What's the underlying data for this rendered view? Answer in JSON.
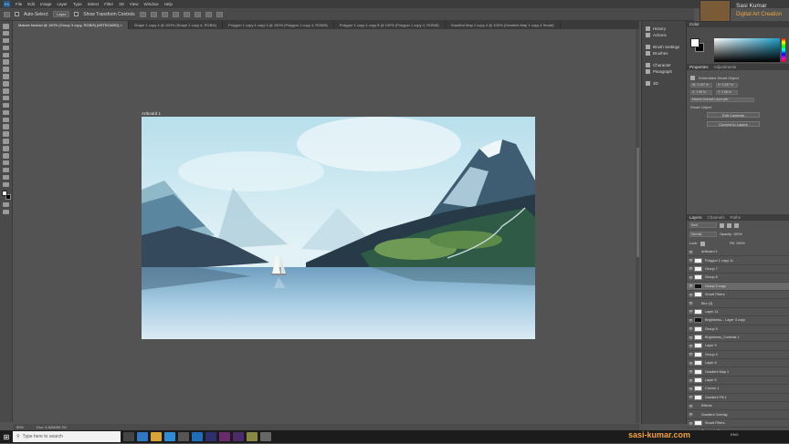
{
  "menu": {
    "logo": "Ps",
    "items": [
      "File",
      "Edit",
      "Image",
      "Layer",
      "Type",
      "Select",
      "Filter",
      "3D",
      "View",
      "Window",
      "Help"
    ]
  },
  "options_bar": {
    "auto_select_label": "Auto-Select:",
    "auto_select_value": "Layer",
    "show_transform_label": "Show Transform Controls"
  },
  "tabs": [
    {
      "label": "Mature-Nomad @ 100% (Group 3 copy, RGB/8) [ARTBOARD] ×",
      "active": true
    },
    {
      "label": "Shape 1 copy 4 @ 100% (Shape 1 copy 4, RGB/8)",
      "active": false
    },
    {
      "label": "Polygon 1 copy 4 copy 4 @ 100% (Polygon 1 copy 4, RGB/8)",
      "active": false
    },
    {
      "label": "Polygon 1 copy 4 copy 8 @ 100% (Polygon 1 copy 4, RGB/8)",
      "active": false
    },
    {
      "label": "Gradient Map 1 copy 4 @ 100% (Gradient Map 1 copy 4 Smart)",
      "active": false
    }
  ],
  "canvas": {
    "artboard_label": "Artboard 1"
  },
  "status": {
    "zoom": "50%",
    "doc": "Doc: 6.62M/69.7M"
  },
  "mid_panel": {
    "items": [
      {
        "label": "History",
        "icon": "history-icon"
      },
      {
        "label": "Actions",
        "icon": "actions-icon"
      },
      {
        "label": "Brush Settings",
        "icon": "brush-settings-icon"
      },
      {
        "label": "Brushes",
        "icon": "brushes-icon"
      },
      {
        "label": "Character",
        "icon": "character-icon"
      },
      {
        "label": "Paragraph",
        "icon": "paragraph-icon"
      },
      {
        "label": "3D",
        "icon": "3d-icon"
      }
    ]
  },
  "color_panel": {
    "title": "Color",
    "fg": "#ffffff",
    "bg": "#000000",
    "hue_color": "#1f9ec9"
  },
  "properties_panel": {
    "tabs": [
      "Properties",
      "Adjustments"
    ],
    "object_label": "Embedded Smart Object",
    "w": "W: 1.107 in",
    "h": "H: 1.067 in",
    "x": "X: 1.98 in",
    "y": "Y: 1.56 in",
    "file_label": "Mature-Nomad Layer.psb",
    "smart_label": "Smart Object",
    "btn_edit": "Edit Contents",
    "btn_convert": "Convert to Layers"
  },
  "layers_panel": {
    "tabs": [
      "Layers",
      "Channels",
      "Paths"
    ],
    "kind": "Kind",
    "blend": "Normal",
    "opacity": "Opacity: 100%",
    "lock": "Lock:",
    "fill": "Fill: 100%",
    "rows": [
      {
        "name": "Artboard 1",
        "thumb": "none",
        "selected": false
      },
      {
        "name": "Polygon 1 copy 11",
        "thumb": "light",
        "selected": false
      },
      {
        "name": "Group 7",
        "thumb": "light",
        "selected": false
      },
      {
        "name": "Group 6",
        "thumb": "light",
        "selected": false
      },
      {
        "name": "Group 3 copy",
        "thumb": "dark",
        "selected": true
      },
      {
        "name": "Smart Filters",
        "thumb": "light",
        "selected": false
      },
      {
        "name": "Blur (3)",
        "thumb": "none",
        "selected": false
      },
      {
        "name": "Layer 11",
        "thumb": "light",
        "selected": false
      },
      {
        "name": "Brightness... Layer 3 copy",
        "thumb": "dark",
        "selected": false
      },
      {
        "name": "Group 5",
        "thumb": "light",
        "selected": false
      },
      {
        "name": "Brightness_Contrast 1",
        "thumb": "light",
        "selected": false
      },
      {
        "name": "Layer 9",
        "thumb": "light",
        "selected": false
      },
      {
        "name": "Group 4",
        "thumb": "light",
        "selected": false
      },
      {
        "name": "Layer 6",
        "thumb": "light",
        "selected": false
      },
      {
        "name": "Gradient Map 1",
        "thumb": "light",
        "selected": false
      },
      {
        "name": "Layer 5",
        "thumb": "light",
        "selected": false
      },
      {
        "name": "Curves 1",
        "thumb": "light",
        "selected": false
      },
      {
        "name": "Gradient Fill 1",
        "thumb": "light",
        "selected": false
      },
      {
        "name": "Effects",
        "thumb": "none",
        "selected": false
      },
      {
        "name": "Gradient Overlay",
        "thumb": "none",
        "selected": false
      },
      {
        "name": "Smart Filters",
        "thumb": "light",
        "selected": false
      },
      {
        "name": "Gaussian Blur",
        "thumb": "none",
        "selected": false
      },
      {
        "name": "Effects 5",
        "thumb": "light",
        "selected": false
      },
      {
        "name": "Smart Filters",
        "thumb": "light",
        "selected": false
      },
      {
        "name": "Gaussian Blur",
        "thumb": "none",
        "selected": false
      }
    ]
  },
  "overlay": {
    "brand_name": "Sasi Kumar",
    "brand_sub": "Digital Art Creation",
    "watermark": "sasi-kumar.com"
  },
  "taskbar": {
    "search_placeholder": "Type here to search",
    "tray": "ENG"
  }
}
